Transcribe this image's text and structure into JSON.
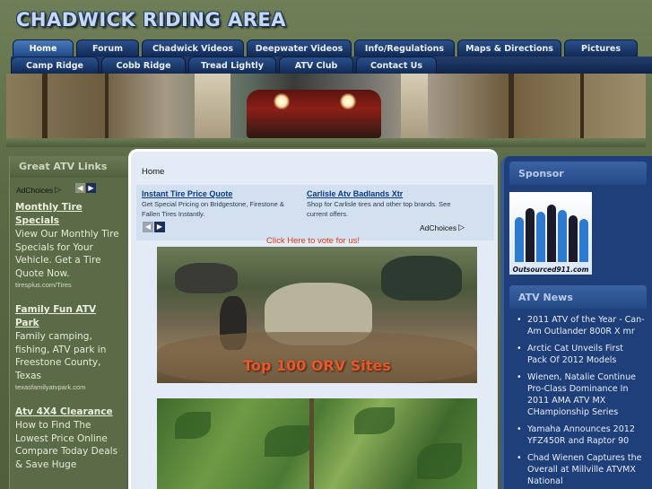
{
  "header": {
    "title": "CHADWICK RIDING AREA"
  },
  "nav_row1": [
    {
      "label": "Home",
      "active": true,
      "width": 68
    },
    {
      "label": "Forum",
      "active": false,
      "width": 70
    },
    {
      "label": "Chadwick Videos",
      "active": false,
      "width": 114
    },
    {
      "label": "Deepwater Videos",
      "active": false,
      "width": 117
    },
    {
      "label": "Info/Regulations",
      "active": false,
      "width": 112
    },
    {
      "label": "Maps & Directions",
      "active": false,
      "width": 116
    },
    {
      "label": "Pictures",
      "active": false,
      "width": 82
    }
  ],
  "nav_row2": [
    {
      "label": "Camp Ridge",
      "width": 98
    },
    {
      "label": "Cobb Ridge",
      "width": 94
    },
    {
      "label": "Tread Lightly",
      "width": 98
    },
    {
      "label": "ATV Club",
      "width": 83
    },
    {
      "label": "Contact Us",
      "width": 90
    }
  ],
  "left_sidebar": {
    "heading": "Great ATV Links",
    "adchoices": "AdChoices",
    "ads": [
      {
        "title": "Monthly Tire Specials",
        "desc": "View Our Monthly Tire Specials for Your Vehicle. Get a Tire Quote Now.",
        "url": "tiresplus.com/Tires"
      },
      {
        "title": "Family Fun ATV Park",
        "desc": "Family camping, fishing, ATV park in Freestone County, Texas",
        "url": "texasfamilyatvpark.com"
      },
      {
        "title": "Atv 4X4 Clearance",
        "desc": "How to Find The Lowest Price Online Compare Today Deals & Save Huge",
        "url": ""
      }
    ]
  },
  "main": {
    "breadcrumb": "Home",
    "ads": [
      {
        "title": "Instant Tire Price Quote",
        "desc": "Get Special Pricing on Bridgestone, Firestone & Fallen Tires Instantly."
      },
      {
        "title": "Carlisle Atv Badlands Xtr",
        "desc": "Shop for Carlisle tires and other top brands. See current offers."
      }
    ],
    "adchoices": "AdChoices",
    "vote_link": "Click Here to vote for us!",
    "photo_caption": "Top 100 ORV Sites"
  },
  "right_sidebar": {
    "sponsor_heading": "Sponsor",
    "sponsor_caption": "Outsourced911.com",
    "news_heading": "ATV News",
    "news": [
      "2011 ATV of the Year - Can-Am Outlander 800R X mr",
      "Arctic Cat Unveils First Pack Of 2012 Models",
      "Wienen, Natalie Continue Pro-Class Dominance In 2011 AMA ATV MX CHampionship Series",
      "Yamaha Announces 2012 YFZ450R and Raptor 90",
      "Chad Wienen Captures the Overall at Millville ATVMX National"
    ]
  },
  "colors": {
    "nav_tab": "#1a3a6e",
    "page_bg": "#5e6d4a",
    "right_bg": "#1f3f7a",
    "vote_link": "#e03b10"
  }
}
